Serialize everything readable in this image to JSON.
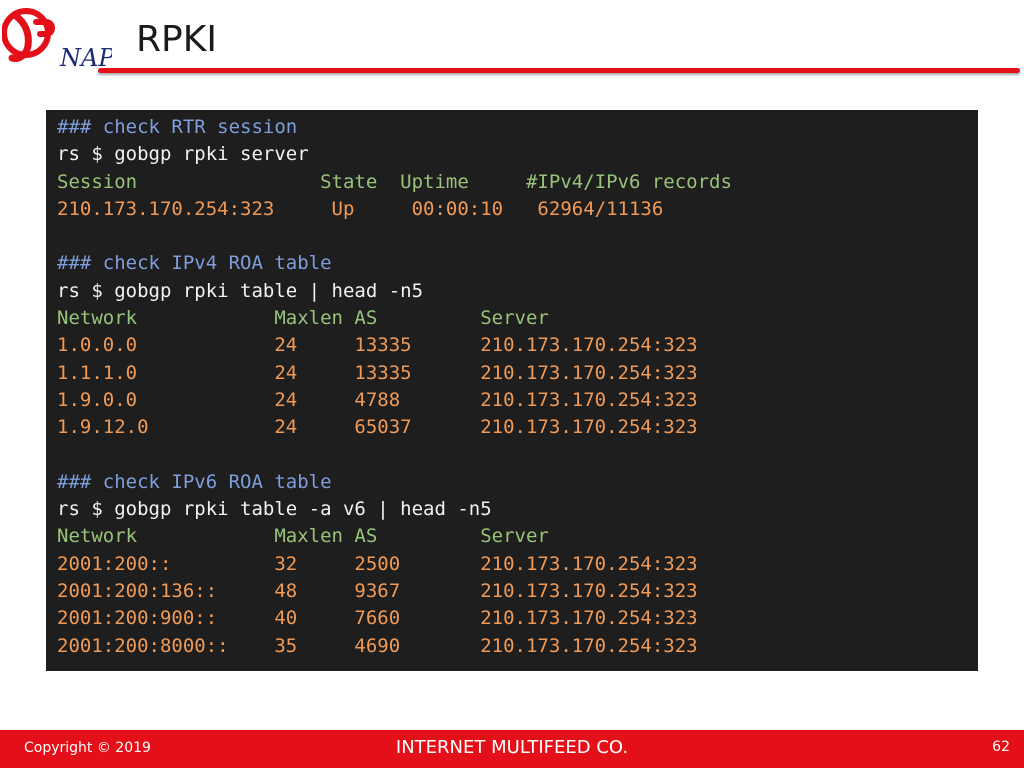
{
  "slide": {
    "title": "RPKI",
    "logo_text": "NAP"
  },
  "terminal": {
    "lines": [
      {
        "type": "comment",
        "text": "### check RTR session"
      },
      {
        "type": "cmd",
        "text": "rs $ gobgp rpki server"
      },
      {
        "type": "header",
        "text": "Session                State  Uptime     #IPv4/IPv6 records"
      },
      {
        "type": "data",
        "text": "210.173.170.254:323     Up     00:00:10   62964/11136"
      },
      {
        "type": "blank",
        "text": " "
      },
      {
        "type": "comment",
        "text": "### check IPv4 ROA table"
      },
      {
        "type": "cmd",
        "text": "rs $ gobgp rpki table | head -n5"
      },
      {
        "type": "header",
        "text": "Network            Maxlen AS         Server"
      },
      {
        "type": "data",
        "text": "1.0.0.0            24     13335      210.173.170.254:323"
      },
      {
        "type": "data",
        "text": "1.1.1.0            24     13335      210.173.170.254:323"
      },
      {
        "type": "data",
        "text": "1.9.0.0            24     4788       210.173.170.254:323"
      },
      {
        "type": "data",
        "text": "1.9.12.0           24     65037      210.173.170.254:323"
      },
      {
        "type": "blank",
        "text": " "
      },
      {
        "type": "comment",
        "text": "### check IPv6 ROA table"
      },
      {
        "type": "cmd",
        "text": "rs $ gobgp rpki table -a v6 | head -n5"
      },
      {
        "type": "header",
        "text": "Network            Maxlen AS         Server"
      },
      {
        "type": "data",
        "text": "2001:200::         32     2500       210.173.170.254:323"
      },
      {
        "type": "data",
        "text": "2001:200:136::     48     9367       210.173.170.254:323"
      },
      {
        "type": "data",
        "text": "2001:200:900::     40     7660       210.173.170.254:323"
      },
      {
        "type": "data",
        "text": "2001:200:8000::    35     4690       210.173.170.254:323"
      }
    ]
  },
  "footer": {
    "copyright": "Copyright © 2019",
    "company": "INTERNET MULTIFEED CO.",
    "page_number": "62"
  },
  "colors": {
    "brand_red": "#e3101a",
    "terminal_bg": "#1e1e1e",
    "comment": "#7e9edc",
    "command": "#f2f2f2",
    "header": "#98c379",
    "data": "#f09a55"
  }
}
